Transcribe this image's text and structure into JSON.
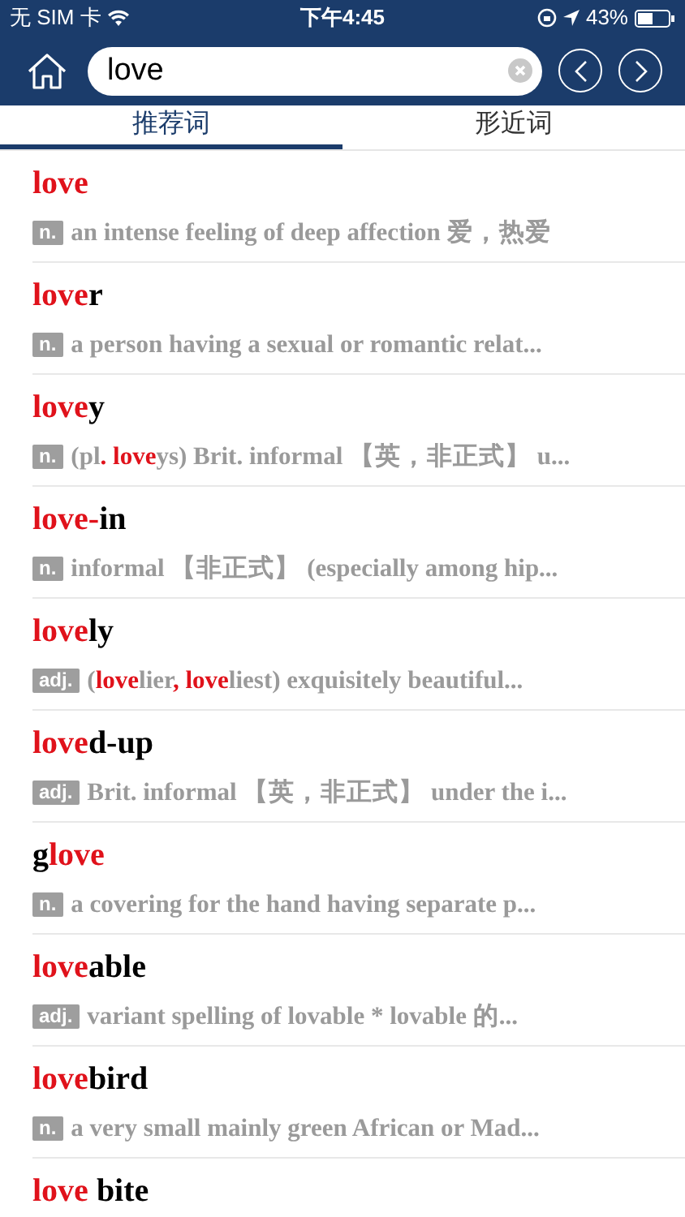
{
  "status_bar": {
    "carrier": "无 SIM 卡",
    "time": "下午4:45",
    "battery": "43%"
  },
  "search": {
    "value": "love"
  },
  "tabs": [
    {
      "label": "推荐词",
      "selected": true
    },
    {
      "label": "形近词",
      "selected": false
    }
  ],
  "entries": [
    {
      "word": [
        {
          "text": "love",
          "match": true
        }
      ],
      "pos": "n.",
      "definition": [
        {
          "text": "an intense feeling of deep affection 爱，热爱",
          "match": false
        }
      ]
    },
    {
      "word": [
        {
          "text": "love",
          "match": true
        },
        {
          "text": "r",
          "match": false
        }
      ],
      "pos": "n.",
      "definition": [
        {
          "text": "a person having a sexual or romantic relat...",
          "match": false
        }
      ]
    },
    {
      "word": [
        {
          "text": "love",
          "match": true
        },
        {
          "text": "y",
          "match": false
        }
      ],
      "pos": "n.",
      "definition": [
        {
          "text": "(pl",
          "match": false
        },
        {
          "text": ". love",
          "match": true
        },
        {
          "text": "ys) Brit. informal 【英，非正式】 u...",
          "match": false
        }
      ]
    },
    {
      "word": [
        {
          "text": "love-",
          "match": true
        },
        {
          "text": "in",
          "match": false
        }
      ],
      "pos": "n.",
      "definition": [
        {
          "text": "informal 【非正式】 (especially among hip...",
          "match": false
        }
      ]
    },
    {
      "word": [
        {
          "text": "love",
          "match": true
        },
        {
          "text": "ly",
          "match": false
        }
      ],
      "pos": "adj.",
      "definition": [
        {
          "text": "(",
          "match": false
        },
        {
          "text": "love",
          "match": true
        },
        {
          "text": "lier",
          "match": false
        },
        {
          "text": ", love",
          "match": true
        },
        {
          "text": "liest) exquisitely beautiful...",
          "match": false
        }
      ]
    },
    {
      "word": [
        {
          "text": "love",
          "match": true
        },
        {
          "text": "d-up",
          "match": false
        }
      ],
      "pos": "adj.",
      "definition": [
        {
          "text": "Brit. informal 【英，非正式】 under the i...",
          "match": false
        }
      ]
    },
    {
      "word": [
        {
          "text": "g",
          "match": false
        },
        {
          "text": "love",
          "match": true
        }
      ],
      "pos": "n.",
      "definition": [
        {
          "text": "a covering for the hand having separate p...",
          "match": false
        }
      ]
    },
    {
      "word": [
        {
          "text": "love",
          "match": true
        },
        {
          "text": "able",
          "match": false
        }
      ],
      "pos": "adj.",
      "definition": [
        {
          "text": "variant spelling of lovable  *  lovable 的...",
          "match": false
        }
      ]
    },
    {
      "word": [
        {
          "text": "love",
          "match": true
        },
        {
          "text": "bird",
          "match": false
        }
      ],
      "pos": "n.",
      "definition": [
        {
          "text": "a very small mainly green African or Mad...",
          "match": false
        }
      ]
    },
    {
      "word": [
        {
          "text": "love",
          "match": true
        },
        {
          "text": " bite",
          "match": false
        }
      ]
    }
  ]
}
